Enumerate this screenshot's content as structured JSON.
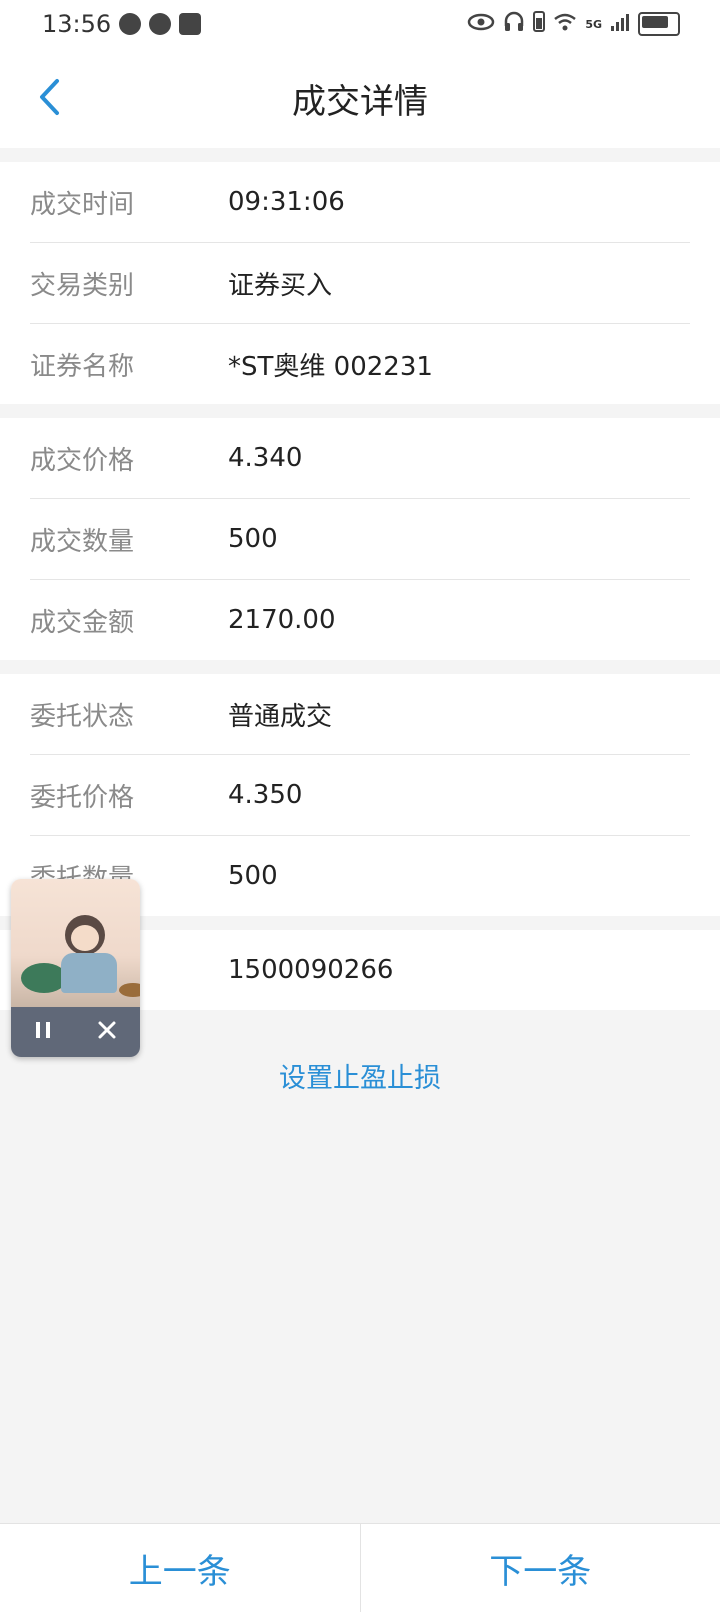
{
  "status_bar": {
    "time": "13:56",
    "network": "5G"
  },
  "header": {
    "title": "成交详情",
    "back_icon": "chevron-left-icon"
  },
  "groups": [
    {
      "rows": [
        {
          "label": "成交时间",
          "value": "09:31:06"
        },
        {
          "label": "交易类别",
          "value": "证券买入"
        },
        {
          "label": "证券名称",
          "value": "*ST奥维 002231"
        }
      ]
    },
    {
      "rows": [
        {
          "label": "成交价格",
          "value": "4.340"
        },
        {
          "label": "成交数量",
          "value": "500"
        },
        {
          "label": "成交金额",
          "value": "2170.00"
        }
      ]
    },
    {
      "rows": [
        {
          "label": "委托状态",
          "value": "普通成交"
        },
        {
          "label": "委托价格",
          "value": "4.350"
        },
        {
          "label": "委托数量",
          "value": "500"
        }
      ]
    },
    {
      "rows": [
        {
          "label": "",
          "value": "1500090266"
        }
      ]
    }
  ],
  "action_link": "设置止盈止损",
  "bottom_nav": {
    "prev": "上一条",
    "next": "下一条"
  },
  "floating_player": {
    "pause_icon": "pause-icon",
    "close_icon": "close-icon"
  },
  "colors": {
    "accent": "#2a8fd6",
    "label": "#8a8a8a",
    "background": "#f4f4f4"
  }
}
